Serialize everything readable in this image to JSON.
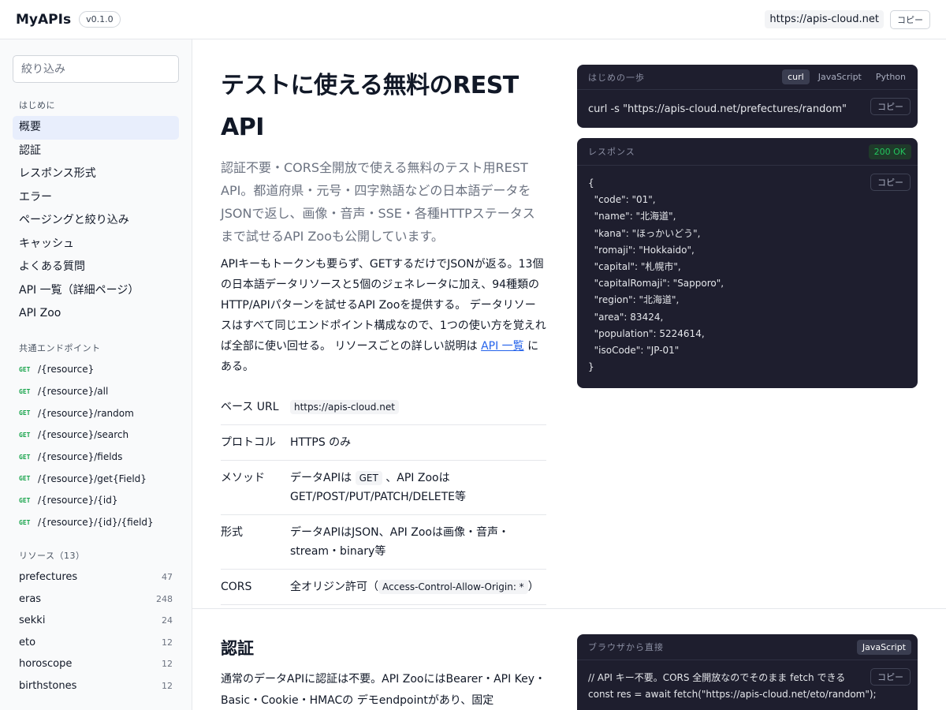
{
  "header": {
    "brand": "MyAPIs",
    "version": "v0.1.0",
    "base_url": "https://apis-cloud.net",
    "copy_label": "コピー"
  },
  "sidebar": {
    "filter_placeholder": "絞り込み",
    "intro_heading": "はじめに",
    "intro_items": [
      {
        "label": "概要",
        "active": true
      },
      {
        "label": "認証"
      },
      {
        "label": "レスポンス形式"
      },
      {
        "label": "エラー"
      },
      {
        "label": "ページングと絞り込み"
      },
      {
        "label": "キャッシュ"
      },
      {
        "label": "よくある質問"
      },
      {
        "label": "API 一覧（詳細ページ）"
      },
      {
        "label": "API Zoo"
      }
    ],
    "endpoints_heading": "共通エンドポイント",
    "endpoints": [
      {
        "method": "GET",
        "path": "/{resource}"
      },
      {
        "method": "GET",
        "path": "/{resource}/all"
      },
      {
        "method": "GET",
        "path": "/{resource}/random"
      },
      {
        "method": "GET",
        "path": "/{resource}/search"
      },
      {
        "method": "GET",
        "path": "/{resource}/fields"
      },
      {
        "method": "GET",
        "path": "/{resource}/get{Field}"
      },
      {
        "method": "GET",
        "path": "/{resource}/{id}"
      },
      {
        "method": "GET",
        "path": "/{resource}/{id}/{field}"
      }
    ],
    "resources_heading": "リソース（13）",
    "resources": [
      {
        "name": "prefectures",
        "count": "47"
      },
      {
        "name": "eras",
        "count": "248"
      },
      {
        "name": "sekki",
        "count": "24"
      },
      {
        "name": "eto",
        "count": "12"
      },
      {
        "name": "horoscope",
        "count": "12"
      },
      {
        "name": "birthstones",
        "count": "12"
      }
    ]
  },
  "main": {
    "title_line1": "テストに使える無料のREST",
    "title_line2": "API",
    "lead": "認証不要・CORS全開放で使える無料のテスト用REST API。都道府県・元号・四字熟語などの日本語データをJSONで返し、画像・音声・SSE・各種HTTPステータスまで試せるAPI Zooも公開しています。",
    "body_before_link": "APIキーもトークンも要らず、GETするだけでJSONが返る。13個の日本語データリソースと5個のジェネレータに加え、94種類のHTTP/APIパターンを試せるAPI Zooを提供する。 データリソースはすべて同じエンドポイント構成なので、1つの使い方を覚えれば全部に使い回せる。 リソースごとの詳しい説明は ",
    "body_link": "API 一覧",
    "body_after_link": " にある。",
    "info": {
      "base_url_key": "ベース URL",
      "base_url_val": "https://apis-cloud.net",
      "protocol_key": "プロトコル",
      "protocol_val": "HTTPS のみ",
      "method_key": "メソッド",
      "method_pre": "データAPIは ",
      "method_chip": "GET",
      "method_post": " 、API Zooは GET/POST/PUT/PATCH/DELETE等",
      "format_key": "形式",
      "format_val": "データAPIはJSON、API Zooは画像・音声・stream・binary等",
      "cors_key": "CORS",
      "cors_pre": "全オリジン許可（",
      "cors_chip": "Access-Control-Allow-Origin: *",
      "cors_post": "）"
    },
    "auth_title": "認証",
    "auth_text": "通常のデータAPIに認証は不要。API ZooにはBearer・API Key・Basic・Cookie・HMACの デモendpointがあり、固定"
  },
  "panels": {
    "start": {
      "title": "はじめの一歩",
      "tabs": [
        "curl",
        "JavaScript",
        "Python"
      ],
      "code": "curl -s \"https://apis-cloud.net/prefectures/random\"",
      "copy": "コピー"
    },
    "response": {
      "title": "レスポンス",
      "status": "200 OK",
      "code": "{\n  \"code\": \"01\",\n  \"name\": \"北海道\",\n  \"kana\": \"ほっかいどう\",\n  \"romaji\": \"Hokkaido\",\n  \"capital\": \"札幌市\",\n  \"capitalRomaji\": \"Sapporo\",\n  \"region\": \"北海道\",\n  \"area\": 83424,\n  \"population\": 5224614,\n  \"isoCode\": \"JP-01\"\n}",
      "copy": "コピー"
    },
    "browser": {
      "title": "ブラウザから直接",
      "tab": "JavaScript",
      "code": "// API キー不要。CORS 全開放なのでそのまま fetch できる\nconst res = await fetch(\"https://apis-cloud.net/eto/random\");",
      "copy": "コピー"
    }
  }
}
